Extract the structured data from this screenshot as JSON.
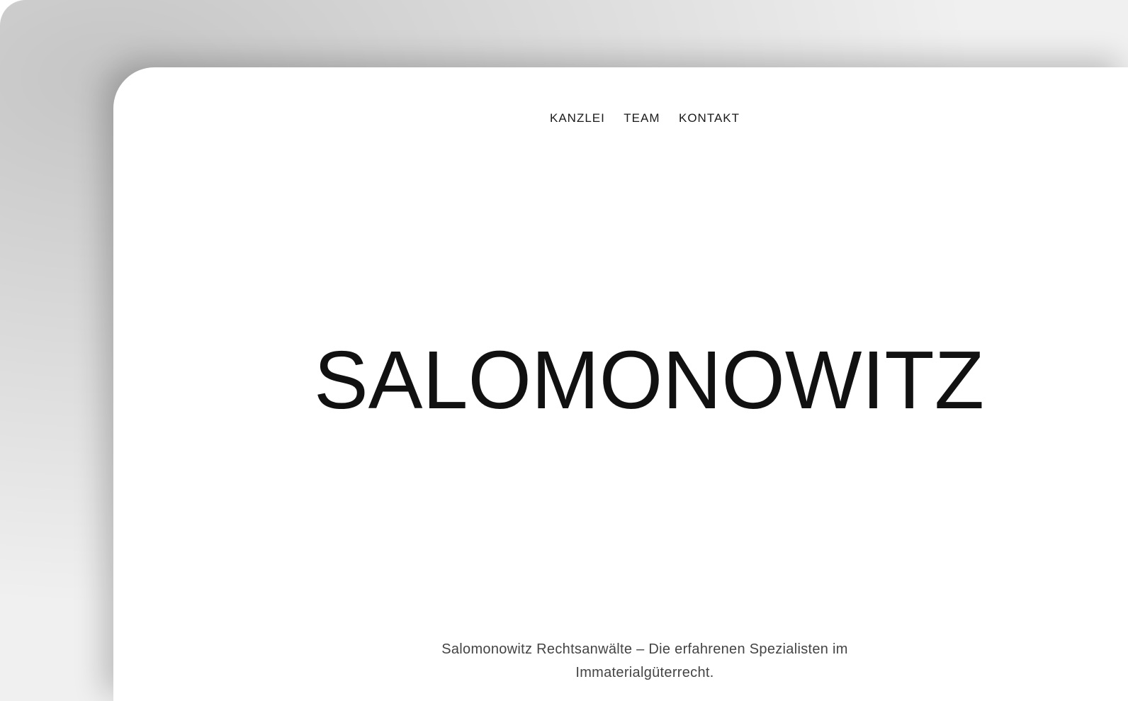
{
  "nav": {
    "items": [
      {
        "label": "KANZLEI"
      },
      {
        "label": "TEAM"
      },
      {
        "label": "KONTAKT"
      }
    ]
  },
  "logo": {
    "text": "SALOMONOWITZ"
  },
  "tagline": {
    "line1": "Salomonowitz Rechtsanwälte – Die erfahrenen Spezialisten im",
    "line2": "Immaterialgüterrecht."
  },
  "colors": {
    "text": "#111111",
    "nav_text": "#1a1a1a",
    "tagline_text": "#444444",
    "background": "#ffffff",
    "backdrop": "#f0f0f0"
  }
}
